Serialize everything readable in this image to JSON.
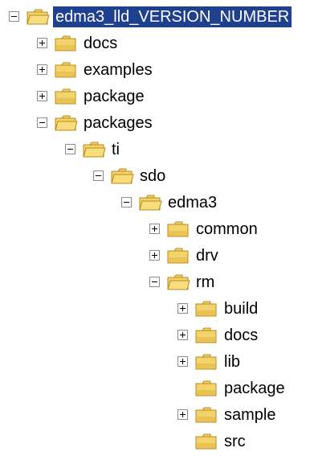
{
  "tree": [
    {
      "label": "edma3_lld_VERSION_NUMBER",
      "depth": 0,
      "toggle": "minus",
      "selected": true
    },
    {
      "label": "docs",
      "depth": 1,
      "toggle": "plus",
      "selected": false
    },
    {
      "label": "examples",
      "depth": 1,
      "toggle": "plus",
      "selected": false
    },
    {
      "label": "package",
      "depth": 1,
      "toggle": "plus",
      "selected": false
    },
    {
      "label": "packages",
      "depth": 1,
      "toggle": "minus",
      "selected": false
    },
    {
      "label": "ti",
      "depth": 2,
      "toggle": "minus",
      "selected": false
    },
    {
      "label": "sdo",
      "depth": 3,
      "toggle": "minus",
      "selected": false
    },
    {
      "label": "edma3",
      "depth": 4,
      "toggle": "minus",
      "selected": false
    },
    {
      "label": "common",
      "depth": 5,
      "toggle": "plus",
      "selected": false
    },
    {
      "label": "drv",
      "depth": 5,
      "toggle": "plus",
      "selected": false
    },
    {
      "label": "rm",
      "depth": 5,
      "toggle": "minus",
      "selected": false
    },
    {
      "label": "build",
      "depth": 6,
      "toggle": "plus",
      "selected": false
    },
    {
      "label": "docs",
      "depth": 6,
      "toggle": "plus",
      "selected": false
    },
    {
      "label": "lib",
      "depth": 6,
      "toggle": "plus",
      "selected": false
    },
    {
      "label": "package",
      "depth": 6,
      "toggle": "none",
      "selected": false
    },
    {
      "label": "sample",
      "depth": 6,
      "toggle": "plus",
      "selected": false
    },
    {
      "label": "src",
      "depth": 6,
      "toggle": "none",
      "selected": false
    }
  ],
  "icons": {
    "folder": "folder-icon",
    "expand": "expand-icon",
    "collapse": "collapse-icon"
  },
  "colors": {
    "folder_fill": "#f3d36b",
    "folder_edge": "#b88a1d",
    "selection": "#1f3f8f",
    "toggle_border": "#8c8c8c"
  }
}
